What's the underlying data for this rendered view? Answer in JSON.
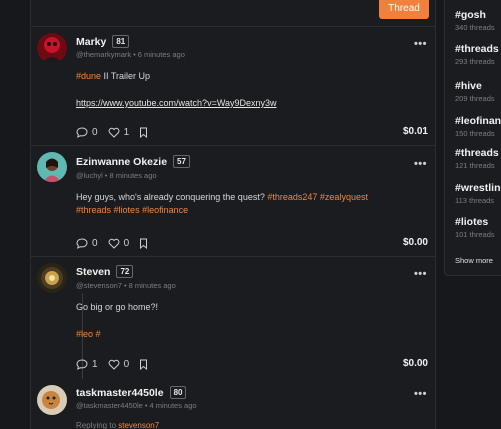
{
  "header": {
    "thread_button": "Thread"
  },
  "posts": [
    {
      "author": "Marky",
      "reputation": "81",
      "handle": "@themarkymark",
      "time": "6 minutes ago",
      "tag1": "#dune",
      "text_rest": " II Trailer Up",
      "link": "https://www.youtube.com/watch?v=Way9Dexny3w",
      "comments": "0",
      "likes": "1",
      "payout": "$0.01"
    },
    {
      "author": "Ezinwanne Okezie",
      "reputation": "57",
      "handle": "@luchyl",
      "time": "8 minutes ago",
      "text": "Hey guys, who's already conquering the quest?",
      "tags_line1": [
        "#threads247",
        "#zealyquest"
      ],
      "tags_line2": [
        "#threads",
        "#liotes",
        "#leofinance"
      ],
      "comments": "0",
      "likes": "0",
      "payout": "$0.00"
    },
    {
      "author": "Steven",
      "reputation": "72",
      "handle": "@stevenson7",
      "time": "8 minutes ago",
      "text": "Go big or go home?!",
      "tags": [
        "#leo",
        "#"
      ],
      "comments": "1",
      "likes": "0",
      "payout": "$0.00"
    },
    {
      "author": "taskmaster4450le",
      "reputation": "80",
      "handle": "@taskmaster4450le",
      "time": "4 minutes ago",
      "replying_prefix": "Replying to ",
      "replying_to": "stevenson7"
    }
  ],
  "trending": [
    {
      "tag": "#gosh",
      "count": "340 threads"
    },
    {
      "tag": "#threads",
      "count": "293 threads"
    },
    {
      "tag": "#hive",
      "count": "209 threads"
    },
    {
      "tag": "#leofinance",
      "count": "150 threads"
    },
    {
      "tag": "#threads",
      "count": "121 threads"
    },
    {
      "tag": "#wrestling",
      "count": "113 threads"
    },
    {
      "tag": "#liotes",
      "count": "101 threads"
    }
  ],
  "show_more": "Show more",
  "colors": {
    "accent": "#f0803c",
    "background": "#17181b",
    "text": "#e9e9ea",
    "muted": "#7c7d82"
  },
  "icons": [
    "comment-icon",
    "heart-icon",
    "bookmark-icon",
    "more-icon"
  ]
}
